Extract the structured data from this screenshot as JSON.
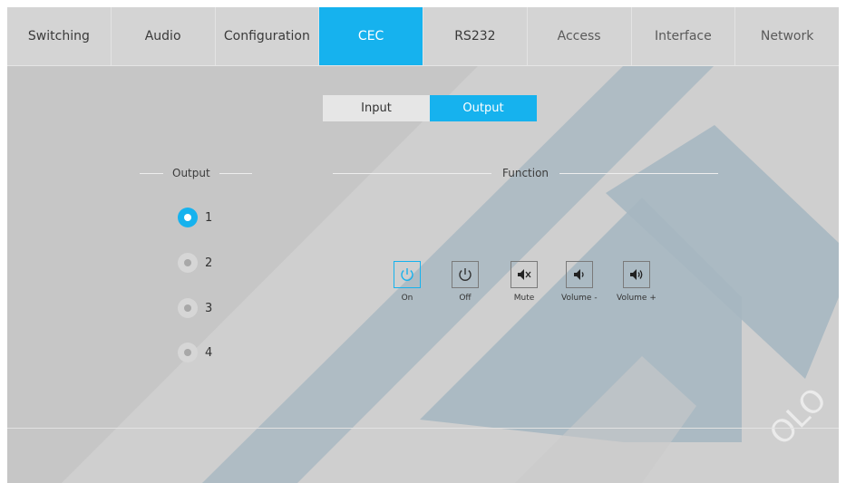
{
  "nav": {
    "tabs": [
      {
        "label": "Switching"
      },
      {
        "label": "Audio"
      },
      {
        "label": "Configuration"
      },
      {
        "label": "CEC"
      },
      {
        "label": "RS232"
      },
      {
        "label": "Access"
      },
      {
        "label": "Interface"
      },
      {
        "label": "Network"
      }
    ],
    "active": "CEC"
  },
  "mode_toggle": {
    "input_label": "Input",
    "output_label": "Output",
    "selected": "Output"
  },
  "output_section": {
    "title": "Output",
    "options": [
      "1",
      "2",
      "3",
      "4"
    ],
    "selected": "1"
  },
  "function_section": {
    "title": "Function",
    "buttons": [
      {
        "label": "On",
        "icon": "power-icon"
      },
      {
        "label": "Off",
        "icon": "power-icon"
      },
      {
        "label": "Mute",
        "icon": "speaker-mute-icon"
      },
      {
        "label": "Volume -",
        "icon": "volume-down-icon"
      },
      {
        "label": "Volume +",
        "icon": "volume-up-icon"
      }
    ]
  },
  "colors": {
    "accent": "#16b2ee",
    "background": "#c9c9c9"
  }
}
